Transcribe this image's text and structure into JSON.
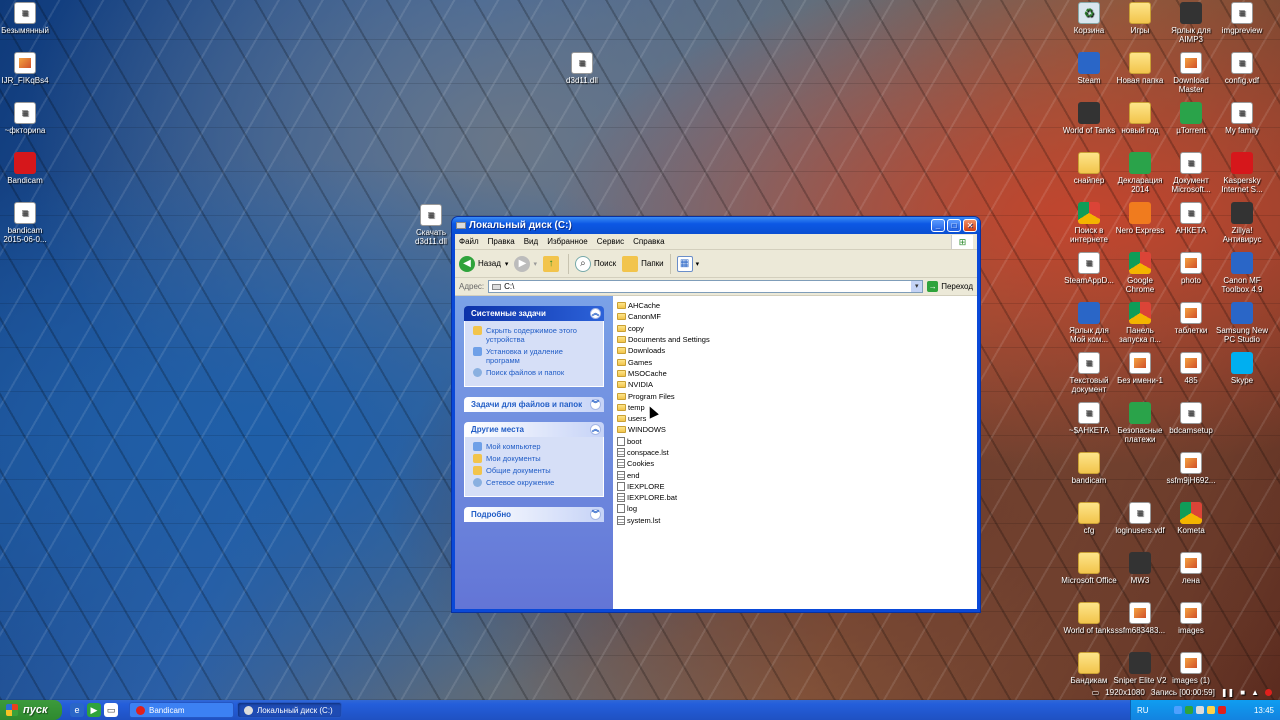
{
  "desktop": {
    "left_icons": [
      {
        "label": "Безымянный",
        "glyph": "doc"
      },
      {
        "label": "IJR_FIKqBs4",
        "glyph": "img"
      },
      {
        "label": "~фктopиnа",
        "glyph": "doc"
      },
      {
        "label": "Bandicam",
        "glyph": "red"
      },
      {
        "label": "bandicam 2015-06-0...",
        "glyph": "doc"
      }
    ],
    "mid_icons": [
      {
        "label": "Скачать d3d11.dll",
        "glyph": "doc"
      },
      {
        "label": "d3d11.dll",
        "glyph": "doc"
      }
    ],
    "right_icons": [
      {
        "label": "Корзина",
        "glyph": "recycle"
      },
      {
        "label": "Игры",
        "glyph": "folder"
      },
      {
        "label": "Ярлык для AIMP3",
        "glyph": "dark"
      },
      {
        "label": "imgpreview",
        "glyph": "doc"
      },
      {
        "label": "Steam",
        "glyph": "blue"
      },
      {
        "label": "Новая папка",
        "glyph": "folder"
      },
      {
        "label": "Download Master",
        "glyph": "img"
      },
      {
        "label": "config.vdf",
        "glyph": "doc"
      },
      {
        "label": "World of Tanks",
        "glyph": "dark"
      },
      {
        "label": "новый год",
        "glyph": "folder"
      },
      {
        "label": "µTorrent",
        "glyph": "green"
      },
      {
        "label": "My family",
        "glyph": "doc"
      },
      {
        "label": "снайпер",
        "glyph": "folder"
      },
      {
        "label": "Декларация 2014",
        "glyph": "green"
      },
      {
        "label": "Документ Microsoft...",
        "glyph": "doc"
      },
      {
        "label": "Kaspersky Internet S...",
        "glyph": "red"
      },
      {
        "label": "Поиск в интернете",
        "glyph": "chrome"
      },
      {
        "label": "Nero Express",
        "glyph": "orange"
      },
      {
        "label": "АНКЕТА",
        "glyph": "doc"
      },
      {
        "label": "Zillya! Антивирус",
        "glyph": "dark"
      },
      {
        "label": "SteamAppD...",
        "glyph": "doc"
      },
      {
        "label": "Google Chrome",
        "glyph": "chrome"
      },
      {
        "label": "photo",
        "glyph": "img"
      },
      {
        "label": "Canon MF Toolbox 4.9",
        "glyph": "blue"
      },
      {
        "label": "Ярлык для Мой ком...",
        "glyph": "blue"
      },
      {
        "label": "Панель запуска п...",
        "glyph": "chrome"
      },
      {
        "label": "таблетки",
        "glyph": "img"
      },
      {
        "label": "Samsung New PC Studio",
        "glyph": "blue"
      },
      {
        "label": "Текстовый документ",
        "glyph": "doc"
      },
      {
        "label": "Без имени-1",
        "glyph": "img"
      },
      {
        "label": "485",
        "glyph": "img"
      },
      {
        "label": "Skype",
        "glyph": "cyan"
      },
      {
        "label": "~$АНКЕТА",
        "glyph": "doc"
      },
      {
        "label": "Безопасные платежи",
        "glyph": "green"
      },
      {
        "label": "bdcamsetup",
        "glyph": "doc"
      },
      {
        "label": "",
        "glyph": ""
      },
      {
        "label": "bandicam",
        "glyph": "folder"
      },
      {
        "label": "",
        "glyph": ""
      },
      {
        "label": "ssfm9jH692...",
        "glyph": "img"
      },
      {
        "label": "",
        "glyph": ""
      },
      {
        "label": "cfg",
        "glyph": "folder"
      },
      {
        "label": "loginusers.vdf",
        "glyph": "doc"
      },
      {
        "label": "Kometa",
        "glyph": "chrome"
      },
      {
        "label": "",
        "glyph": ""
      },
      {
        "label": "Microsoft Office",
        "glyph": "folder"
      },
      {
        "label": "MW3",
        "glyph": "dark"
      },
      {
        "label": "лена",
        "glyph": "img"
      },
      {
        "label": "",
        "glyph": ""
      },
      {
        "label": "World of tanks",
        "glyph": "folder"
      },
      {
        "label": "ssfm683483...",
        "glyph": "img"
      },
      {
        "label": "images",
        "glyph": "img"
      },
      {
        "label": "",
        "glyph": ""
      },
      {
        "label": "Бандикам",
        "glyph": "folder"
      },
      {
        "label": "Sniper Elite V2",
        "glyph": "dark"
      },
      {
        "label": "images (1)",
        "glyph": "img"
      }
    ]
  },
  "window": {
    "title": "Локальный диск (C:)",
    "menu": [
      "Файл",
      "Правка",
      "Вид",
      "Избранное",
      "Сервис",
      "Справка"
    ],
    "toolbar": {
      "back": "Назад",
      "search": "Поиск",
      "folders": "Папки"
    },
    "address_label": "Адрес:",
    "address_value": "C:\\",
    "go_label": "Переход",
    "panels": [
      {
        "title": "Системные задачи",
        "links": [
          "Скрыть содержимое этого устройства",
          "Установка и удаление программ",
          "Поиск файлов и папок"
        ]
      },
      {
        "title": "Задачи для файлов и папок",
        "links": []
      },
      {
        "title": "Другие места",
        "links": [
          "Мой компьютер",
          "Мои документы",
          "Общие документы",
          "Сетевое окружение"
        ]
      },
      {
        "title": "Подробно",
        "links": []
      }
    ],
    "files": [
      {
        "name": "AHCache",
        "type": "folder"
      },
      {
        "name": "CanonMF",
        "type": "folder"
      },
      {
        "name": "copy",
        "type": "folder"
      },
      {
        "name": "Documents and Settings",
        "type": "folder"
      },
      {
        "name": "Downloads",
        "type": "folder"
      },
      {
        "name": "Games",
        "type": "folder"
      },
      {
        "name": "MSOCache",
        "type": "folder"
      },
      {
        "name": "NVIDIA",
        "type": "folder"
      },
      {
        "name": "Program Files",
        "type": "folder"
      },
      {
        "name": "temp",
        "type": "folder"
      },
      {
        "name": "users",
        "type": "folder"
      },
      {
        "name": "WINDOWS",
        "type": "folder"
      },
      {
        "name": "boot",
        "type": "file"
      },
      {
        "name": "conspace.lst",
        "type": "sys"
      },
      {
        "name": "Cookies",
        "type": "sys"
      },
      {
        "name": "end",
        "type": "sys"
      },
      {
        "name": "IEXPLORE",
        "type": "file"
      },
      {
        "name": "IEXPLORE.bat",
        "type": "sys"
      },
      {
        "name": "log",
        "type": "file"
      },
      {
        "name": "system.lst",
        "type": "sys"
      }
    ]
  },
  "taskbar": {
    "start_label": "пуск",
    "tasks": [
      {
        "label": "Bandicam",
        "active": false
      },
      {
        "label": "Локальный диск (C:)",
        "active": true
      }
    ],
    "lang": "RU",
    "clock": "13:45"
  },
  "recorder": {
    "resolution": "1920x1080",
    "status": "Запись [00:00:59]"
  }
}
